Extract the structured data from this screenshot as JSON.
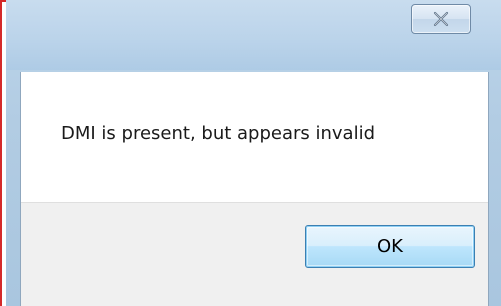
{
  "dialog": {
    "message": "DMI is present, but appears invalid",
    "ok_label": "OK"
  },
  "titlebar": {
    "close_icon": "close-icon"
  },
  "colors": {
    "frame_highlight": "#d42a2a",
    "window_chrome": "#b2cce3",
    "button_strip": "#f0f0f0",
    "ok_button_border": "#3c7fb1"
  }
}
